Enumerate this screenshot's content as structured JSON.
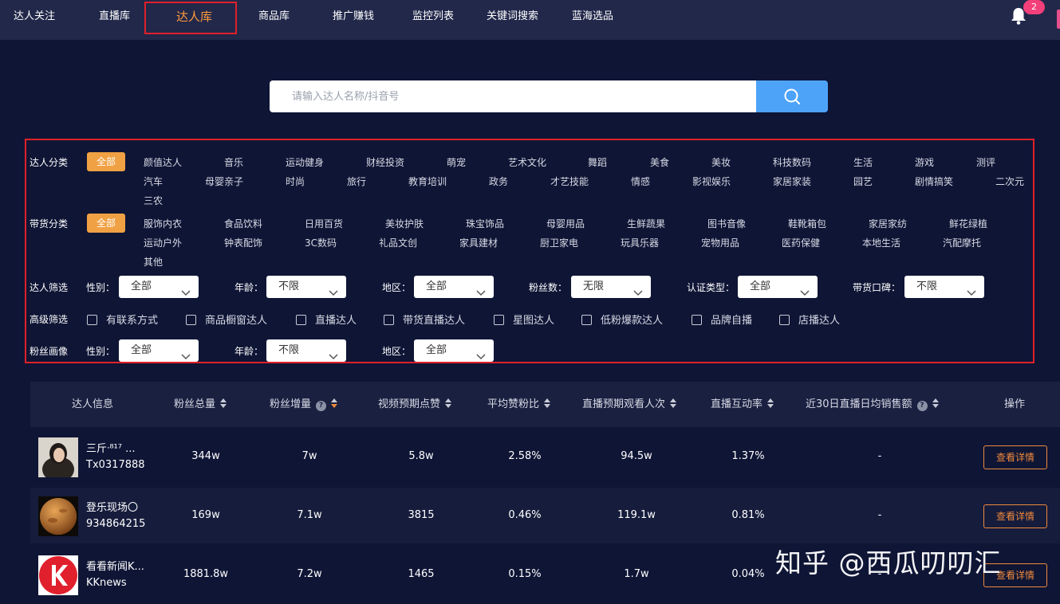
{
  "nav": {
    "items": [
      "达人关注",
      "直播库",
      "达人库",
      "商品库",
      "推广赚钱",
      "监控列表",
      "关键词搜索",
      "蓝海选品"
    ],
    "active_index": 2,
    "notification_count": "2"
  },
  "search": {
    "placeholder": "请输入达人名称/抖音号"
  },
  "filters": {
    "category_label": "达人分类",
    "all_label": "全部",
    "categories": [
      "颜值达人",
      "音乐",
      "运动健身",
      "财经投资",
      "萌宠",
      "艺术文化",
      "舞蹈",
      "美食",
      "美妆",
      "科技数码",
      "生活",
      "游戏",
      "测评",
      "汽车",
      "母婴亲子",
      "时尚",
      "旅行",
      "教育培训",
      "政务",
      "才艺技能",
      "情感",
      "影视娱乐",
      "家居家装",
      "园艺",
      "剧情搞笑",
      "二次元",
      "三农"
    ],
    "goods_label": "带货分类",
    "goods": [
      "服饰内衣",
      "食品饮料",
      "日用百货",
      "美妆护肤",
      "珠宝饰品",
      "母婴用品",
      "生鲜蔬果",
      "图书音像",
      "鞋靴箱包",
      "家居家纺",
      "鲜花绿植",
      "运动户外",
      "钟表配饰",
      "3C数码",
      "礼品文创",
      "家具建材",
      "厨卫家电",
      "玩具乐器",
      "宠物用品",
      "医药保健",
      "本地生活",
      "汽配摩托",
      "其他"
    ],
    "screen_label": "达人筛选",
    "screen": [
      {
        "label": "性别：",
        "value": "全部"
      },
      {
        "label": "年龄：",
        "value": "不限"
      },
      {
        "label": "地区：",
        "value": "全部"
      },
      {
        "label": "粉丝数：",
        "value": "无限"
      },
      {
        "label": "认证类型：",
        "value": "全部"
      },
      {
        "label": "带货口碑：",
        "value": "不限"
      }
    ],
    "advanced_label": "高级筛选",
    "advanced": [
      "有联系方式",
      "商品橱窗达人",
      "直播达人",
      "带货直播达人",
      "星图达人",
      "低粉爆款达人",
      "品牌自播",
      "店播达人"
    ],
    "fans_label": "粉丝画像",
    "fans": [
      {
        "label": "性别：",
        "value": "全部"
      },
      {
        "label": "年龄：",
        "value": "不限"
      },
      {
        "label": "地区：",
        "value": "全部"
      }
    ]
  },
  "table": {
    "headers": [
      "达人信息",
      "粉丝总量",
      "粉丝增量",
      "视频预期点赞",
      "平均赞粉比",
      "直播预期观看人次",
      "直播互动率",
      "近30日直播日均销售额",
      "操作"
    ],
    "action_label": "查看详情",
    "rows": [
      {
        "name": "三斤ᐧ⁸¹⁷ ...",
        "uid": "Tx0317888",
        "fans": "344w",
        "growth": "7w",
        "likes": "5.8w",
        "ratio": "2.58%",
        "views": "94.5w",
        "interact": "1.37%",
        "sales": "-"
      },
      {
        "name": "登乐现场〇",
        "uid": "934864215",
        "fans": "169w",
        "growth": "7.1w",
        "likes": "3815",
        "ratio": "0.46%",
        "views": "119.1w",
        "interact": "0.81%",
        "sales": "-"
      },
      {
        "name": "看看新闻K...",
        "uid": "KKnews",
        "fans": "1881.8w",
        "growth": "7.2w",
        "likes": "1465",
        "ratio": "0.15%",
        "views": "1.7w",
        "interact": "0.04%",
        "sales": "-"
      }
    ]
  },
  "watermark": "知乎 @西瓜叨叨汇",
  "colors": {
    "bg": "#0f1535",
    "accent": "#f0a143",
    "search_button": "#4da3f8",
    "highlight_border": "#e0202a"
  }
}
